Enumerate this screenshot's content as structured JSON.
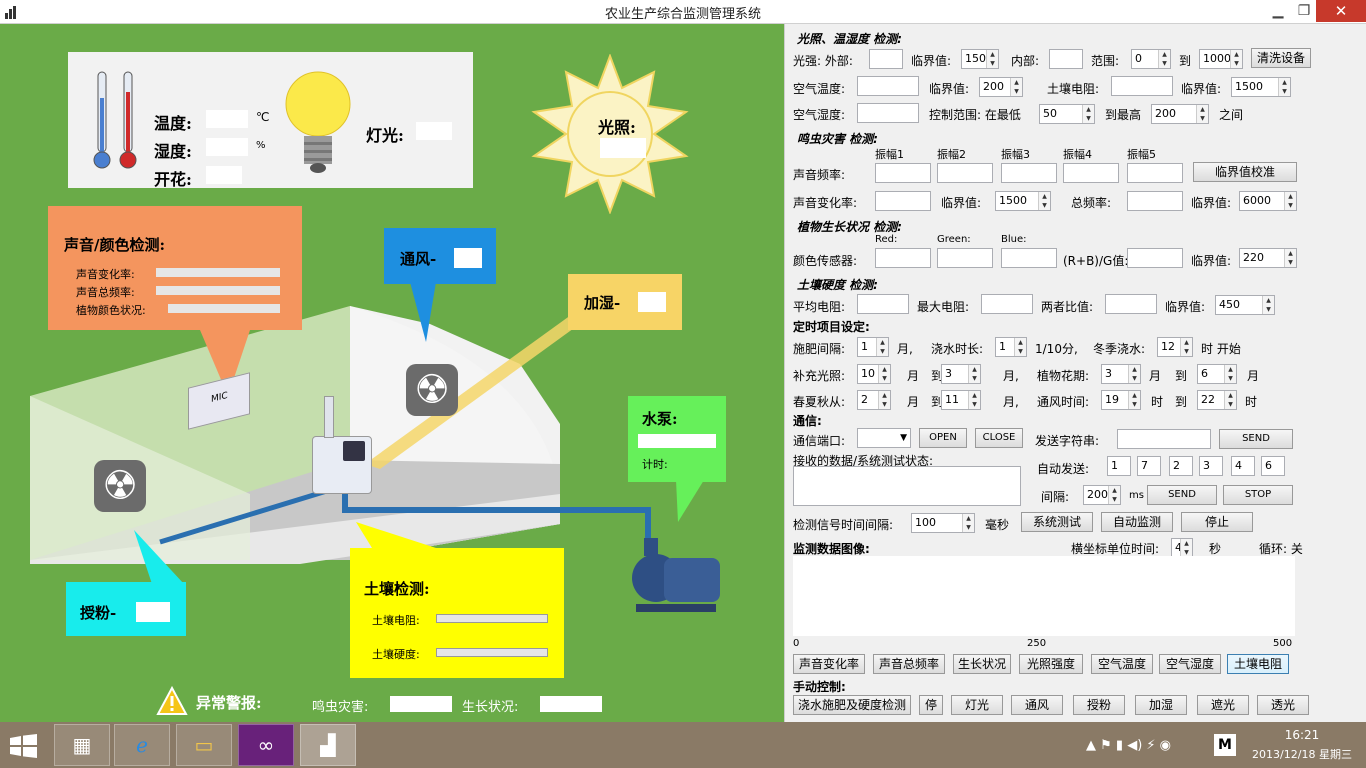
{
  "window": {
    "title": "农业生产综合监测管理系统",
    "min": "▁",
    "max": "❐",
    "close": "✕"
  },
  "left": {
    "temp_label": "温度:",
    "temp_unit": "℃",
    "hum_label": "湿度:",
    "hum_unit": "%",
    "bloom_label": "开花:",
    "light_label": "灯光:",
    "sun_label": "光照:",
    "sound_title": "声音/颜色检测:",
    "sound_rate": "声音变化率:",
    "sound_total": "声音总频率:",
    "plant_color": "植物颜色状况:",
    "fan_label": "通风-",
    "humid_label": "加湿-",
    "pump_title": "水泵:",
    "timer_label": "计时:",
    "pollen_label": "授粉-",
    "soil_title": "土壤检测:",
    "soil_res": "土壤电阻:",
    "soil_hard": "土壤硬度:",
    "alarm_label": "异常警报:",
    "pest_label": "鸣虫灾害:",
    "growth_label": "生长状况:",
    "mic_text": "MIC"
  },
  "right": {
    "sec_light": "光照、温湿度 检测:",
    "light_ext": "光强: 外部:",
    "threshold": "临界值:",
    "light_thr_val": "150",
    "inner": "内部:",
    "range": "范围:",
    "range_min": "0",
    "to": "到",
    "range_max": "1000",
    "clean_btn": "清洗设备",
    "air_temp": "空气温度:",
    "air_temp_thr": "200",
    "soil_res": "土壤电阻:",
    "soil_res_thr": "1500",
    "air_hum": "空气湿度:",
    "ctrl_range": "控制范围: 在最低",
    "hum_low": "50",
    "to_max": "到最高",
    "hum_high": "200",
    "between": "之间",
    "sec_pest": "鸣虫灾害 检测:",
    "amp": [
      "振幅1",
      "振幅2",
      "振幅3",
      "振幅4",
      "振幅5"
    ],
    "sound_freq": "声音频率:",
    "thr_calib": "临界值校准",
    "sound_rate": "声音变化率:",
    "sound_rate_thr": "1500",
    "total_freq": "总频率:",
    "total_thr": "6000",
    "sec_plant": "植物生长状况 检测:",
    "rgb": [
      "Red:",
      "Green:",
      "Blue:"
    ],
    "color_sensor": "颜色传感器:",
    "rbg_ratio": "(R+B)/G值:",
    "color_thr": "220",
    "sec_soil": "土壤硬度 检测:",
    "avg_res": "平均电阻:",
    "max_res": "最大电阻:",
    "ratio": "两者比值:",
    "soil_hard_thr": "450",
    "sec_timer": "定时项目设定:",
    "fert_int": "施肥间隔:",
    "fert_val": "1",
    "month": "月,",
    "water_dur": "浇水时长:",
    "water_val": "1",
    "unit_10min": "1/10分,",
    "winter_water": "冬季浇水:",
    "winter_val": "12",
    "hour_start": "时 开始",
    "sup_light": "补充光照:",
    "sup_from": "10",
    "month2": "月",
    "to2": "到",
    "sup_to": "3",
    "month3": "月,",
    "bloom_period": "植物花期:",
    "bloom_from": "3",
    "month4": "月",
    "to3": "到",
    "bloom_to": "6",
    "month5": "月",
    "spring": "春夏秋从:",
    "spring_from": "2",
    "month6": "月",
    "to4": "到",
    "spring_to": "11",
    "month7": "月,",
    "vent_time": "通风时间:",
    "vent_from": "19",
    "hour": "时",
    "to5": "到",
    "vent_to": "22",
    "hour2": "时",
    "sec_comm": "通信:",
    "comm_port": "通信端口:",
    "open": "OPEN",
    "close": "CLOSE",
    "send_str": "发送字符串:",
    "send": "SEND",
    "recv": "接收的数据/系统测试状态:",
    "auto_send": "自动发送:",
    "auto_vals": [
      "1",
      "7",
      "2",
      "3",
      "4",
      "6"
    ],
    "interval": "间隔:",
    "interval_val": "200",
    "ms": "ms",
    "send2": "SEND",
    "stop": "STOP",
    "det_int": "检测信号时间间隔:",
    "det_val": "100",
    "msec": "毫秒",
    "sys_test": "系统测试",
    "auto_mon": "自动监测",
    "stop2": "停止",
    "graph_title": "监测数据图像:",
    "x_unit": "横坐标单位时间:",
    "x_unit_val": "4",
    "sec": "秒",
    "loop": "循环: 关",
    "ticks": [
      "0",
      "250",
      "500"
    ],
    "graph_btns": [
      "声音变化率",
      "声音总频率",
      "生长状况",
      "光照强度",
      "空气温度",
      "空气湿度",
      "土壤电阻"
    ],
    "manual": "手动控制:",
    "manual_btns": [
      "浇水施肥及硬度检测",
      "停",
      "灯光",
      "通风",
      "授粉",
      "加湿",
      "遮光",
      "透光"
    ]
  },
  "taskbar": {
    "time": "16:21",
    "date": "2013/12/18 星期三"
  }
}
